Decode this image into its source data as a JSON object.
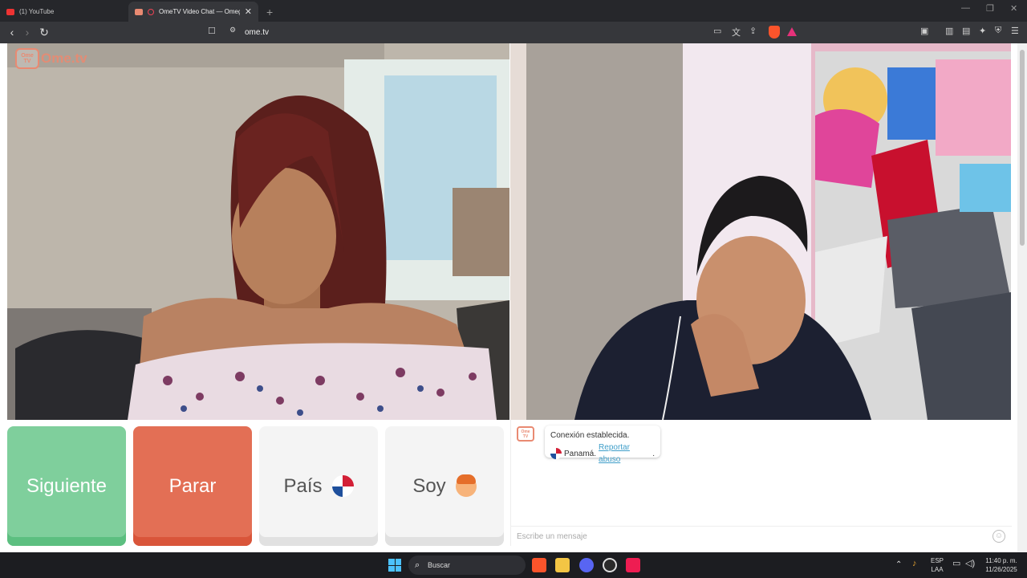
{
  "browser": {
    "tabs": [
      {
        "title": "(1) YouTube",
        "active": false
      },
      {
        "title": "OmeTV Video Chat — Omegl",
        "active": true
      }
    ],
    "url": "ome.tv"
  },
  "app": {
    "logo_badge": "Ome TV",
    "logo_text": "Ome.tv",
    "buttons": {
      "next": "Siguiente",
      "stop": "Parar",
      "country": "País",
      "gender": "Soy"
    },
    "chat": {
      "status": "Conexión establecida.",
      "country": "Panamá.",
      "report": "Reportar abuso",
      "report_suffix": ".",
      "placeholder": "Escribe un mensaje"
    },
    "colors": {
      "next": "#7fcf9c",
      "stop": "#e36f55",
      "link": "#3f9ec9"
    }
  },
  "taskbar": {
    "search_label": "Buscar",
    "lang_top": "ESP",
    "lang_bottom": "LAA",
    "time": "11:40 p. m.",
    "date": "11/26/2025",
    "icons": [
      "windows-icon",
      "brave-icon",
      "file-explorer-icon",
      "discord-icon",
      "chatgpt-icon",
      "tiktok-icon"
    ]
  }
}
